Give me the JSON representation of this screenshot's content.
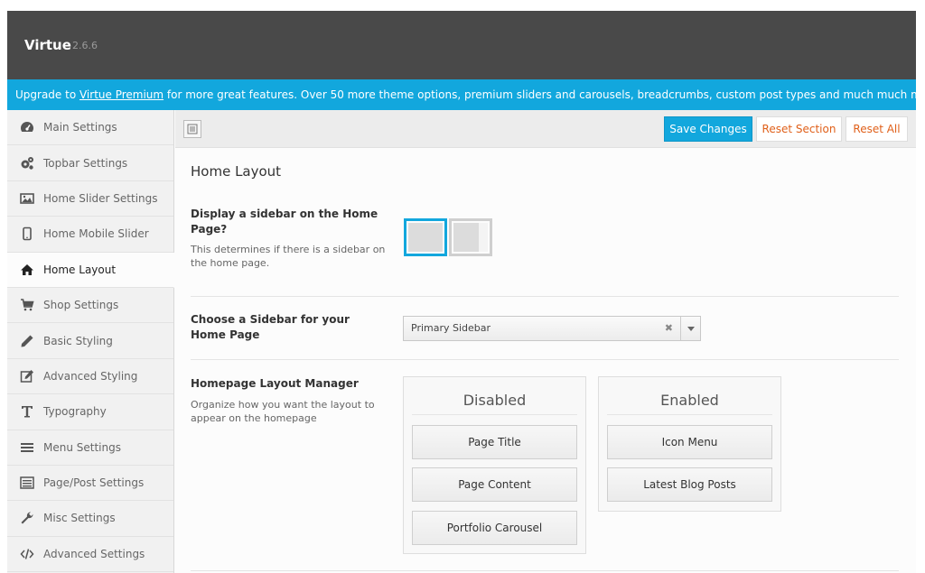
{
  "header": {
    "title": "Virtue",
    "version": "2.6.6"
  },
  "banner": {
    "prefix": "Upgrade to ",
    "link": "Virtue Premium",
    "suffix": " for more great features. Over 50 more theme options, premium sliders and carousels, breadcrumbs, custom post types and much much more!"
  },
  "sidebar": {
    "items": [
      {
        "label": "Main Settings",
        "icon": "dashboard-icon"
      },
      {
        "label": "Topbar Settings",
        "icon": "cogs-icon"
      },
      {
        "label": "Home Slider Settings",
        "icon": "picture-icon"
      },
      {
        "label": "Home Mobile Slider",
        "icon": "mobile-icon"
      },
      {
        "label": "Home Layout",
        "icon": "home-icon",
        "active": true
      },
      {
        "label": "Shop Settings",
        "icon": "cart-icon"
      },
      {
        "label": "Basic Styling",
        "icon": "pencil-icon"
      },
      {
        "label": "Advanced Styling",
        "icon": "edit-icon"
      },
      {
        "label": "Typography",
        "icon": "text-icon"
      },
      {
        "label": "Menu Settings",
        "icon": "list-icon"
      },
      {
        "label": "Page/Post Settings",
        "icon": "list-box-icon"
      },
      {
        "label": "Misc Settings",
        "icon": "wrench-icon"
      },
      {
        "label": "Advanced Settings",
        "icon": "code-icon"
      }
    ]
  },
  "toolbar": {
    "save_label": "Save Changes",
    "reset_section_label": "Reset Section",
    "reset_all_label": "Reset All"
  },
  "main": {
    "title": "Home Layout",
    "sidebar_field": {
      "label": "Display a sidebar on the Home Page?",
      "description": "This determines if there is a sidebar on the home page.",
      "selected": "full-width"
    },
    "choose_sidebar": {
      "label": "Choose a Sidebar for your Home Page",
      "value": "Primary Sidebar"
    },
    "layout_manager": {
      "label": "Homepage Layout Manager",
      "description": "Organize how you want the layout to appear on the homepage",
      "disabled_title": "Disabled",
      "disabled_items": [
        "Page Title",
        "Page Content",
        "Portfolio Carousel"
      ],
      "enabled_title": "Enabled",
      "enabled_items": [
        "Icon Menu",
        "Latest Blog Posts"
      ]
    }
  },
  "colors": {
    "accent": "#12a7dd",
    "header": "#494949",
    "reset": "#e0601a"
  }
}
